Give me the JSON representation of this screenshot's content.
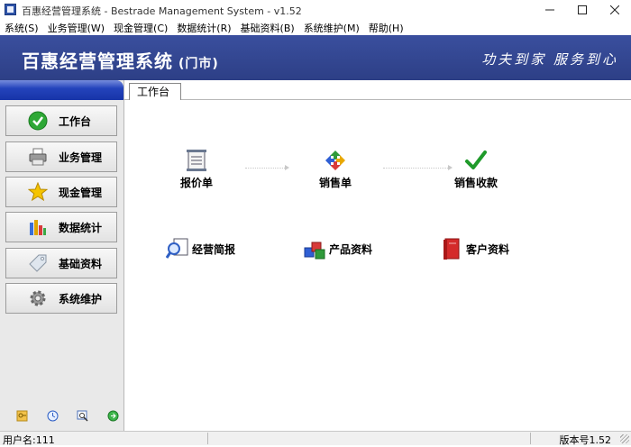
{
  "window": {
    "title": "百惠经营管理系统 - Bestrade Management System - v1.52",
    "minimize_icon": "minimize-icon",
    "maximize_icon": "maximize-icon",
    "close_icon": "close-icon"
  },
  "menu": {
    "items": [
      {
        "label": "系统(S)"
      },
      {
        "label": "业务管理(W)"
      },
      {
        "label": "现金管理(C)"
      },
      {
        "label": "数据统计(R)"
      },
      {
        "label": "基础资料(B)"
      },
      {
        "label": "系统维护(M)"
      },
      {
        "label": "帮助(H)"
      }
    ]
  },
  "header": {
    "title": "百惠经营管理系统",
    "subtitle": "(门市)",
    "slogan": "功夫到家 服务到心",
    "colors": {
      "banner": "#3a4f9e",
      "sidebar_header": "#2c4ec9"
    }
  },
  "sidebar": {
    "items": [
      {
        "label": "工作台",
        "icon": "green-check-icon"
      },
      {
        "label": "业务管理",
        "icon": "printer-icon"
      },
      {
        "label": "现金管理",
        "icon": "star-icon"
      },
      {
        "label": "数据统计",
        "icon": "bar-chart-icon"
      },
      {
        "label": "基础资料",
        "icon": "tag-icon"
      },
      {
        "label": "系统维护",
        "icon": "gear-icon"
      }
    ],
    "tools": [
      {
        "icon": "key-icon"
      },
      {
        "icon": "clock-icon"
      },
      {
        "icon": "search-window-icon"
      },
      {
        "icon": "exit-icon"
      }
    ]
  },
  "main": {
    "tab_label": "工作台",
    "workflow": [
      {
        "label": "报价单",
        "icon": "document-icon"
      },
      {
        "label": "销售单",
        "icon": "recycle-arrows-icon"
      },
      {
        "label": "销售收款",
        "icon": "checkmark-icon"
      }
    ],
    "shortcuts": [
      {
        "label": "经营简报",
        "icon": "magnifier-report-icon"
      },
      {
        "label": "产品资料",
        "icon": "cubes-icon"
      },
      {
        "label": "客户资料",
        "icon": "red-book-icon"
      }
    ]
  },
  "status": {
    "user": "用户名:111",
    "version": "版本号1.52"
  }
}
